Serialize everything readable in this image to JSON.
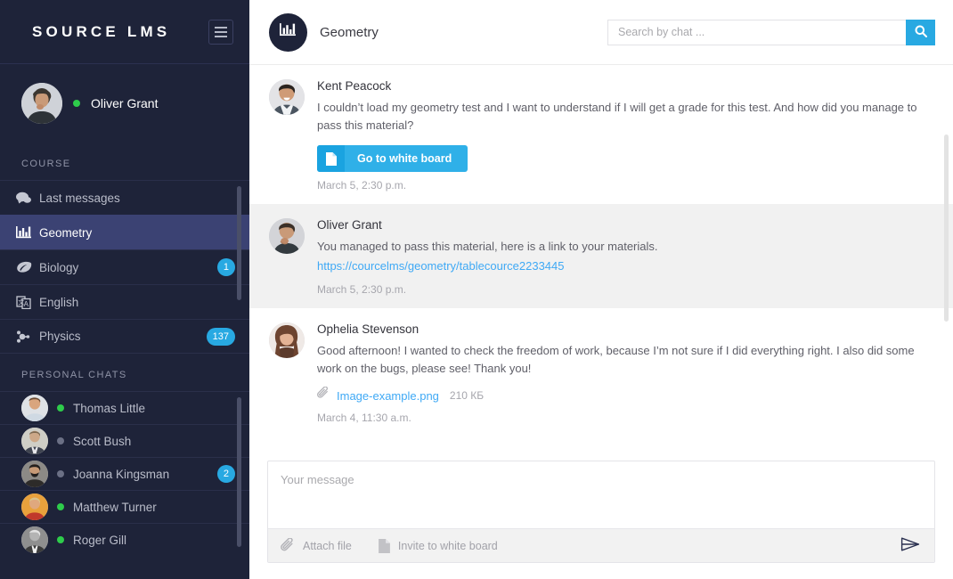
{
  "sidebar": {
    "brand": "SOURCE LMS",
    "menu_icon": "hamburger-icon",
    "profile": {
      "name": "Oliver Grant",
      "status": "online"
    },
    "course_section_label": "COURSE",
    "courses": [
      {
        "label": "Last messages",
        "icon": "chat-bubbles-icon",
        "badge": "",
        "active": false
      },
      {
        "label": "Geometry",
        "icon": "bar-chart-icon",
        "badge": "",
        "active": true
      },
      {
        "label": "Biology",
        "icon": "leaf-icon",
        "badge": "1",
        "active": false
      },
      {
        "label": "English",
        "icon": "translate-icon",
        "badge": "",
        "active": false
      },
      {
        "label": "Physics",
        "icon": "atom-icon",
        "badge": "137",
        "active": false
      }
    ],
    "chats_section_label": "PERSONAL CHATS",
    "chats": [
      {
        "name": "Thomas Little",
        "status": "online",
        "badge": ""
      },
      {
        "name": "Scott Bush",
        "status": "offline",
        "badge": ""
      },
      {
        "name": "Joanna Kingsman",
        "status": "offline",
        "badge": "2"
      },
      {
        "name": "Matthew Turner",
        "status": "online",
        "badge": ""
      },
      {
        "name": "Roger Gill",
        "status": "online",
        "badge": ""
      }
    ]
  },
  "header": {
    "course_title": "Geometry",
    "course_icon": "bar-chart-icon",
    "search": {
      "placeholder": "Search by chat ...",
      "value": "",
      "button_icon": "search-icon"
    }
  },
  "messages": [
    {
      "author": "Kent Peacock",
      "text": "I couldn’t load my geometry test and I want to understand if I will get a grade for this test. And how did you manage to pass this material?",
      "button": {
        "label": "Go to white board",
        "icon": "document-icon"
      },
      "time": "March 5, 2:30 p.m.",
      "self": false
    },
    {
      "author": "Oliver Grant",
      "text": "You managed to pass this material, here is a link to your materials.",
      "link": "https://courcelms/geometry/tablecource2233445",
      "time": "March 5, 2:30 p.m.",
      "self": true
    },
    {
      "author": "Ophelia Stevenson",
      "text": "Good afternoon! I wanted to check the freedom of work, because I’m not sure if I did everything right. I also did some work on the bugs, please see! Thank you!",
      "attachment": {
        "icon": "paperclip-icon",
        "name": "Image-example.png",
        "size": "210 КБ"
      },
      "time": "March 4, 11:30 a.m.",
      "self": false
    }
  ],
  "composer": {
    "placeholder": "Your message",
    "value": "",
    "attach_label": "Attach file",
    "attach_icon": "paperclip-icon",
    "whiteboard_label": "Invite to white board",
    "whiteboard_icon": "document-icon",
    "send_icon": "send-paper-plane-icon"
  },
  "colors": {
    "sidebar_bg": "#1e2339",
    "sidebar_active": "#3b4273",
    "accent_blue": "#28a9e2",
    "link_blue": "#3fa9f5",
    "online_green": "#2ecc4b",
    "self_message_bg": "#f1f1f1"
  }
}
